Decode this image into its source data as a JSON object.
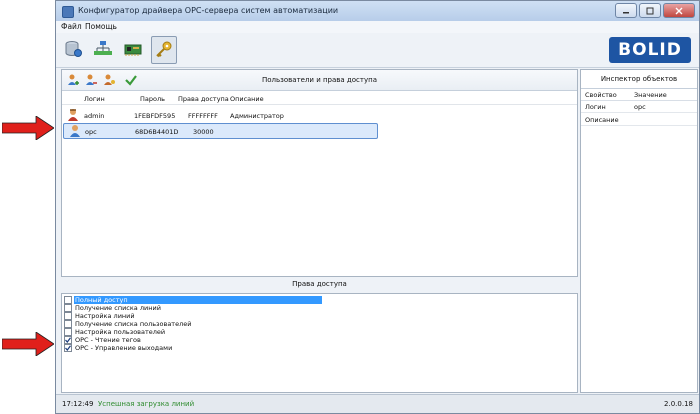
{
  "window": {
    "title": "Конфигуратор драйвера OPC-сервера систем автоматизации"
  },
  "menu": {
    "file": "Файл",
    "help": "Помощь"
  },
  "brand": {
    "logo_text": "BOLID",
    "color": "#1e55a3"
  },
  "toolbar": {
    "buttons": [
      {
        "icon": "database-icon"
      },
      {
        "icon": "network-tree-icon"
      },
      {
        "icon": "device-card-icon"
      },
      {
        "icon": "key-icon",
        "active": true
      }
    ]
  },
  "users_panel": {
    "title": "Пользователи и права доступа",
    "actions": [
      {
        "icon": "add-user-icon"
      },
      {
        "icon": "remove-user-icon"
      },
      {
        "icon": "user-key-icon"
      },
      {
        "icon": "checkmark-icon"
      }
    ],
    "columns": [
      "Логин",
      "Пароль",
      "Права доступа",
      "Описание"
    ],
    "rows": [
      {
        "login": "admin",
        "password": "1FEBFDF595",
        "rights": "FFFFFFFF",
        "description": "Администратор",
        "icon": "admin-user-icon",
        "selected": false
      },
      {
        "login": "opc",
        "password": "68D6B4401D",
        "rights": "30000",
        "description": "",
        "icon": "user-icon",
        "selected": true
      }
    ]
  },
  "rights_panel": {
    "title": "Права доступа",
    "items": [
      {
        "label": "Полный доступ",
        "checked": false,
        "highlighted": true
      },
      {
        "label": "Получение списка линий",
        "checked": false
      },
      {
        "label": "Настройка линий",
        "checked": false
      },
      {
        "label": "Получение списка пользователей",
        "checked": false
      },
      {
        "label": "Настройка пользователей",
        "checked": false
      },
      {
        "label": "OPC - Чтение тегов",
        "checked": true
      },
      {
        "label": "OPC - Управление выходами",
        "checked": true
      }
    ]
  },
  "inspector": {
    "title": "Инспектор объектов",
    "columns": [
      "Свойство",
      "Значение"
    ],
    "rows": [
      {
        "property": "Логин",
        "value": "opc"
      },
      {
        "property": "Описание",
        "value": ""
      }
    ]
  },
  "status": {
    "time": "17:12:49",
    "message": "Успешная загрузка линий",
    "message_color": "#2e8b2e",
    "version": "2.0.0.18"
  },
  "annotations": {
    "arrow_color": "#e0201b"
  }
}
